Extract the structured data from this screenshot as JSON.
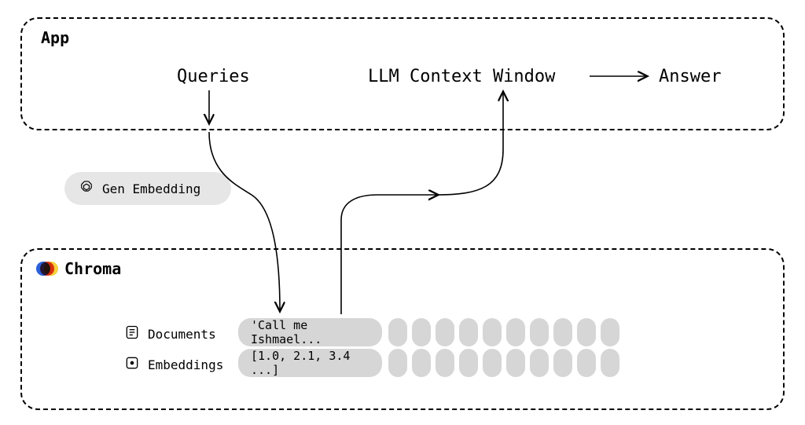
{
  "app_box": {
    "title": "App"
  },
  "chroma_box": {
    "title": "Chroma"
  },
  "nodes": {
    "queries": "Queries",
    "llm_context": "LLM Context Window",
    "answer": "Answer"
  },
  "gen_embedding": {
    "label": "Gen Embedding"
  },
  "rows": {
    "documents_label": "Documents",
    "embeddings_label": "Embeddings",
    "document_sample": "'Call me Ishmael...",
    "embedding_sample": "[1.0, 2.1, 3.4 ...]"
  }
}
